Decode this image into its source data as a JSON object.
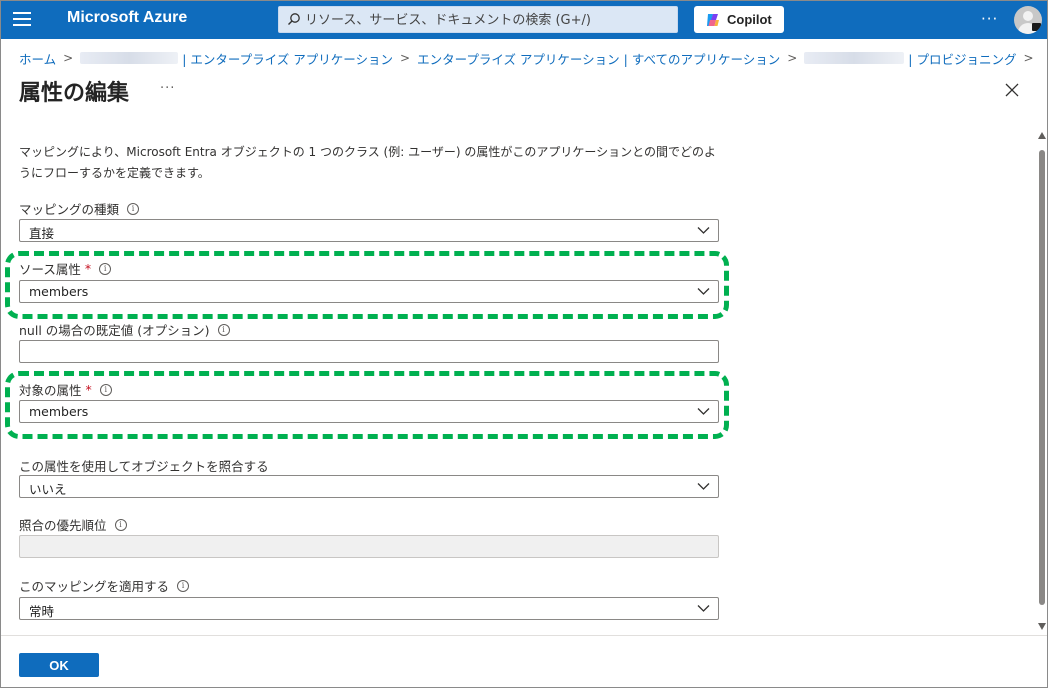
{
  "topbar": {
    "brand": "Microsoft Azure",
    "search_placeholder": "リソース、サービス、ドキュメントの検索 (G+/)",
    "copilot_label": "Copilot",
    "more": "···"
  },
  "breadcrumb": {
    "home": "ホーム",
    "item2": "| エンタープライズ アプリケーション",
    "item3": "エンタープライズ アプリケーション | すべてのアプリケーション",
    "item4": "| プロビジョニング"
  },
  "page": {
    "title": "属性の編集",
    "more": "···",
    "description": "マッピングにより、Microsoft Entra オブジェクトの 1 つのクラス (例: ユーザー) の属性がこのアプリケーションとの間でどのようにフローするかを定義できます。"
  },
  "form": {
    "mapping_type": {
      "label": "マッピングの種類",
      "value": "直接"
    },
    "source_attribute": {
      "label": "ソース属性",
      "required": "*",
      "value": "members"
    },
    "default_value": {
      "label": "null の場合の既定値 (オプション)",
      "value": ""
    },
    "target_attribute": {
      "label": "対象の属性",
      "required": "*",
      "value": "members"
    },
    "match_objects": {
      "label": "この属性を使用してオブジェクトを照合する",
      "value": "いいえ"
    },
    "match_priority": {
      "label": "照合の優先順位",
      "value": ""
    },
    "apply_mapping": {
      "label": "このマッピングを適用する",
      "value": "常時"
    }
  },
  "footer": {
    "ok_label": "OK"
  },
  "colors": {
    "azure_blue": "#0f6cbd",
    "highlight_green": "#00b050",
    "required_red": "#c50f1f"
  }
}
